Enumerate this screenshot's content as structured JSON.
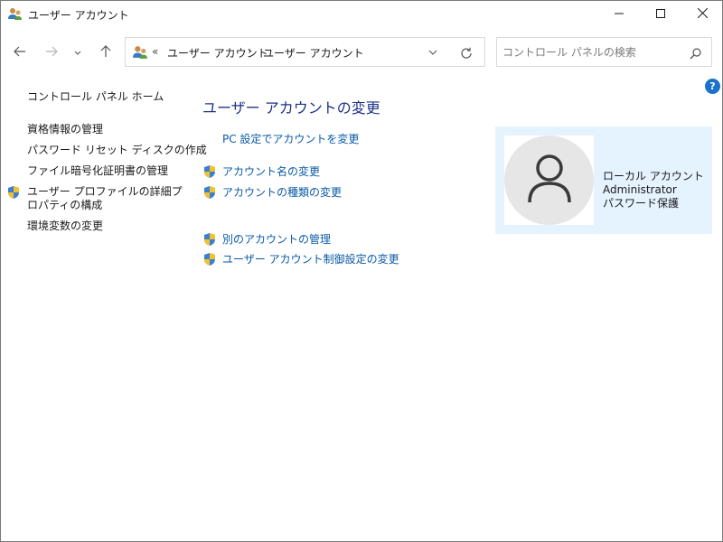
{
  "window": {
    "title": "ユーザー アカウント",
    "icon": "users-icon"
  },
  "nav": {
    "back_icon": "arrow-left-icon",
    "forward_icon": "arrow-right-icon",
    "recent_icon": "chevron-down-icon",
    "up_icon": "arrow-up-icon"
  },
  "address": {
    "overflow": "«",
    "segments": [
      "ユーザー アカウント",
      "ユーザー アカウント"
    ],
    "separator": "›",
    "dropdown_icon": "chevron-down-icon",
    "refresh_icon": "refresh-icon"
  },
  "search": {
    "placeholder": "コントロール パネルの検索",
    "value": "",
    "icon": "magnifier-icon"
  },
  "help": {
    "label": "?"
  },
  "left_pane": {
    "home": "コントロール パネル ホーム",
    "links": [
      "資格情報の管理",
      "パスワード リセット ディスクの作成",
      "ファイル暗号化証明書の管理",
      "ユーザー プロファイルの詳細プロパティの構成",
      "環境変数の変更"
    ]
  },
  "main": {
    "heading": "ユーザー アカウントの変更",
    "pc_settings_link": "PC 設定でアカウントを変更",
    "links": [
      "アカウント名の変更",
      "アカウントの種類の変更",
      "別のアカウントの管理",
      "ユーザー アカウント制御設定の変更"
    ]
  },
  "account": {
    "type": "ローカル アカウント",
    "name": "Administrator",
    "password_status": "パスワード保護",
    "avatar_icon": "person-icon"
  },
  "colors": {
    "heading": "#1e3287",
    "link": "#0a5aa6",
    "card_bg": "#e5f3ff",
    "help_bg": "#1a73c9"
  }
}
